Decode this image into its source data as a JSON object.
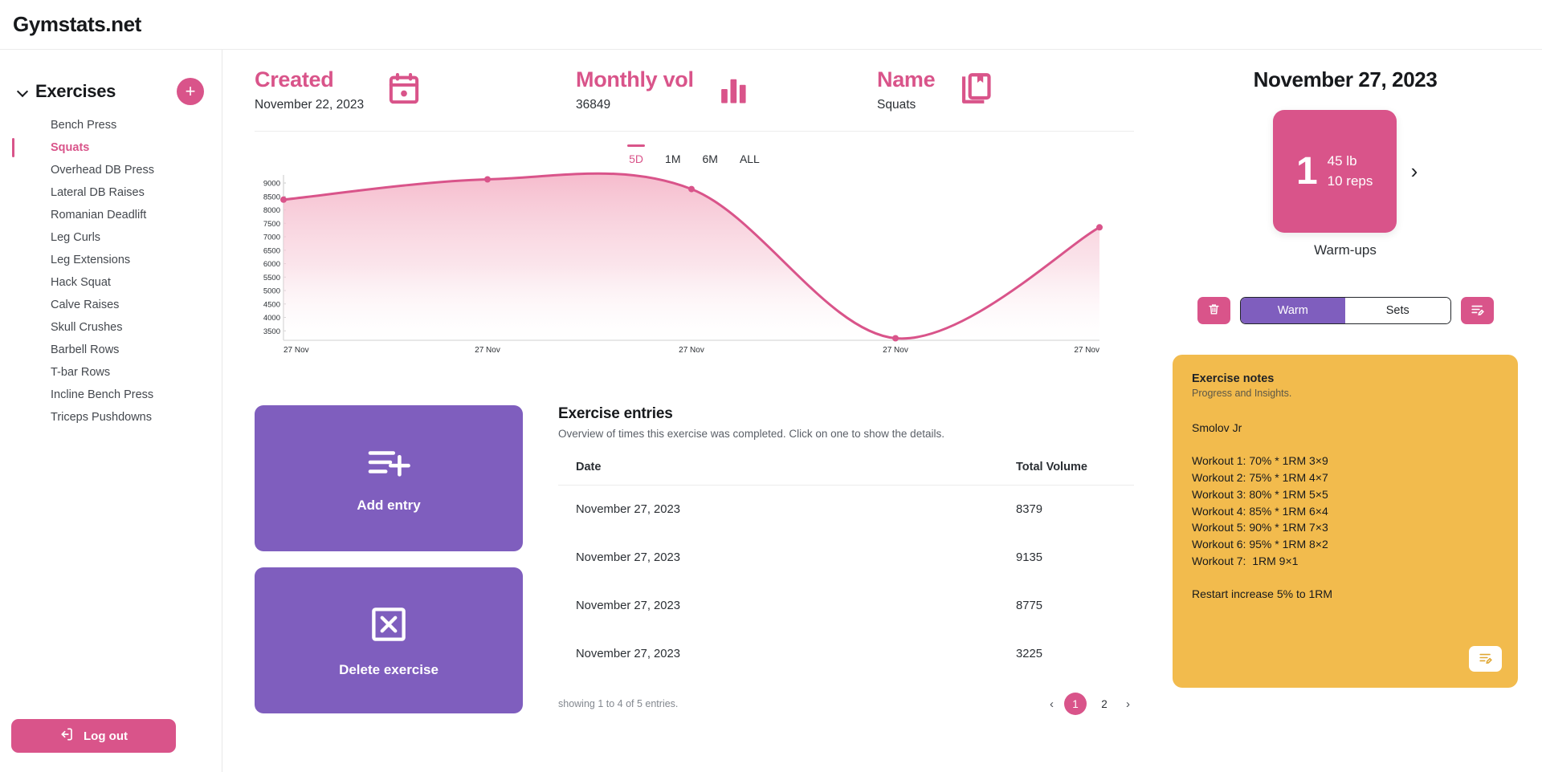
{
  "brand": "Gymstats.net",
  "colors": {
    "accent_pink": "#d9548a",
    "purple": "#7f5ebe",
    "notes_orange": "#f2bb4d",
    "text": "#2b2f34"
  },
  "sidebar": {
    "title": "Exercises",
    "add_label": "+",
    "items": [
      {
        "label": "Bench Press",
        "active": false
      },
      {
        "label": "Squats",
        "active": true
      },
      {
        "label": "Overhead DB Press",
        "active": false
      },
      {
        "label": "Lateral DB Raises",
        "active": false
      },
      {
        "label": "Romanian Deadlift",
        "active": false
      },
      {
        "label": "Leg Curls",
        "active": false
      },
      {
        "label": "Leg Extensions",
        "active": false
      },
      {
        "label": "Hack Squat",
        "active": false
      },
      {
        "label": "Calve Raises",
        "active": false
      },
      {
        "label": "Skull Crushes",
        "active": false
      },
      {
        "label": "Barbell Rows",
        "active": false
      },
      {
        "label": "T-bar Rows",
        "active": false
      },
      {
        "label": "Incline Bench Press",
        "active": false
      },
      {
        "label": "Triceps Pushdowns",
        "active": false
      }
    ],
    "logout_label": "Log out"
  },
  "stats": [
    {
      "label": "Created",
      "value": "November 22, 2023",
      "icon": "calendar-icon"
    },
    {
      "label": "Monthly vol",
      "value": "36849",
      "icon": "bar-chart-icon"
    },
    {
      "label": "Name",
      "value": "Squats",
      "icon": "bookmark-book-icon"
    }
  ],
  "chart_ranges": [
    {
      "label": "5D",
      "active": true
    },
    {
      "label": "1M",
      "active": false
    },
    {
      "label": "6M",
      "active": false
    },
    {
      "label": "ALL",
      "active": false
    }
  ],
  "chart_data": {
    "type": "line",
    "title": "",
    "xlabel": "",
    "ylabel": "",
    "x": [
      "27 Nov",
      "27 Nov",
      "27 Nov",
      "27 Nov",
      "27 Nov"
    ],
    "categories": [
      "27 Nov",
      "27 Nov",
      "27 Nov",
      "27 Nov",
      "27 Nov"
    ],
    "series": [
      {
        "name": "Total Volume",
        "values": [
          8379,
          9135,
          8775,
          3225,
          7350
        ]
      }
    ],
    "values": [
      8379,
      9135,
      8775,
      3225,
      7350
    ],
    "ylim": [
      3225,
      9300
    ],
    "yticks": [
      3500,
      4000,
      4500,
      5000,
      5500,
      6000,
      6500,
      7000,
      7500,
      8000,
      8500,
      9000
    ],
    "grid": false,
    "legend": "none",
    "line_color": "#d9548a",
    "fill": "gradient-pink",
    "smooth": true
  },
  "actions": [
    {
      "label": "Add entry",
      "icon": "list-plus-icon"
    },
    {
      "label": "Delete exercise",
      "icon": "x-box-icon"
    }
  ],
  "entries": {
    "title": "Exercise entries",
    "subtitle": "Overview of times this exercise was completed. Click on one to show the details.",
    "columns": [
      "Date",
      "Total Volume"
    ],
    "rows": [
      {
        "date": "November 27, 2023",
        "volume": "8379"
      },
      {
        "date": "November 27, 2023",
        "volume": "9135"
      },
      {
        "date": "November 27, 2023",
        "volume": "8775"
      },
      {
        "date": "November 27, 2023",
        "volume": "3225"
      }
    ],
    "showing": "showing 1 to 4 of 5 entries.",
    "pages": [
      "1",
      "2"
    ],
    "current_page": "1",
    "prev_icon": "chevron-left-icon",
    "next_icon": "chevron-right-icon"
  },
  "detail": {
    "date": "November 27, 2023",
    "set_number": "1",
    "set_weight": "45 lb",
    "set_reps": "10 reps",
    "next_icon": "chevron-right-icon",
    "set_type_label": "Warm-ups",
    "delete_icon": "trash-icon",
    "edit_icon": "note-edit-icon",
    "segments": [
      {
        "label": "Warm",
        "active": true
      },
      {
        "label": "Sets",
        "active": false
      }
    ]
  },
  "notes": {
    "title": "Exercise notes",
    "subtitle": "Progress and Insights.",
    "body": "Smolov Jr\n\nWorkout 1: 70% * 1RM 3×9\nWorkout 2: 75% * 1RM 4×7\nWorkout 3: 80% * 1RM 5×5\nWorkout 4: 85% * 1RM 6×4\nWorkout 5: 90% * 1RM 7×3\nWorkout 6: 95% * 1RM 8×2\nWorkout 7:  1RM 9×1\n\nRestart increase 5% to 1RM",
    "edit_icon": "note-edit-icon"
  }
}
